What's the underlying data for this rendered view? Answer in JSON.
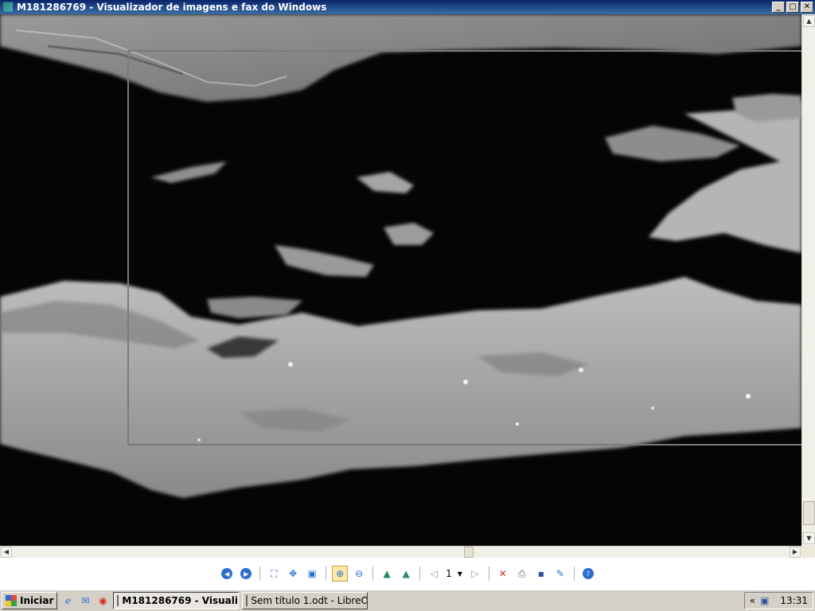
{
  "window": {
    "title": "M181286769 - Visualizador de imagens e fax do Windows",
    "controls": {
      "minimize": "_",
      "maximize": "▢",
      "close": "✕"
    }
  },
  "toolbar": {
    "page_number": "1",
    "buttons": [
      "previous-image-icon",
      "next-image-icon",
      "best-fit-icon",
      "actual-size-icon",
      "slideshow-icon",
      "zoom-in-icon",
      "zoom-out-icon",
      "rotate-clockwise-icon",
      "rotate-counterclockwise-icon",
      "previous-page-icon",
      "page-dropdown-icon",
      "next-page-icon",
      "delete-icon",
      "print-icon",
      "save-icon",
      "edit-icon",
      "help-icon"
    ],
    "active_button": "zoom-in-icon",
    "colors": {
      "nav_blue": "#2b6fcf",
      "delete_red": "#d52b1e",
      "rotate_green": "#2e8b57"
    }
  },
  "taskbar": {
    "start_label": "Iniciar",
    "tasks": [
      {
        "label": "M181286769 - Visuali...",
        "active": true
      },
      {
        "label": "Sem título 1.odt - LibreO...",
        "active": false
      }
    ],
    "tray_chevron": "«",
    "clock": "13:31"
  },
  "colors": {
    "titlebar_start": "#0a246a",
    "titlebar_end": "#3a6ea5",
    "taskbar": "#d4d0c8"
  }
}
